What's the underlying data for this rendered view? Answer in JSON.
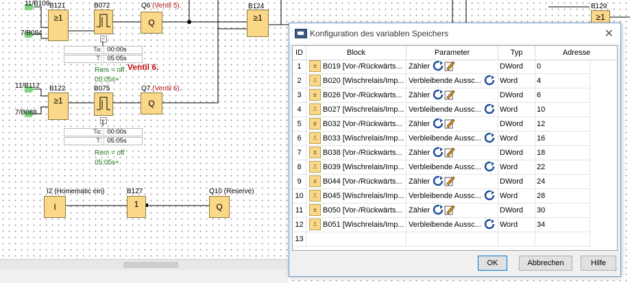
{
  "diagram": {
    "inputs": [
      {
        "label": "11/B109"
      },
      {
        "label": "7/B084"
      },
      {
        "label": "11/B112"
      },
      {
        "label": "7/B088"
      }
    ],
    "blocks": [
      {
        "name": "B121",
        "symbol": "≥1"
      },
      {
        "name": "B072",
        "symbol": ""
      },
      {
        "name": "Q6",
        "symbol": "Q",
        "comment": "(Ventil 5)."
      },
      {
        "name": "B124",
        "symbol": "≥1"
      },
      {
        "name": "B122",
        "symbol": "≥1"
      },
      {
        "name": "B075",
        "symbol": ""
      },
      {
        "name": "Q7",
        "symbol": "Q",
        "comment": "(Ventil 6)."
      },
      {
        "name": "I2 (Homematic ein)",
        "symbol": "I"
      },
      {
        "name": "B127",
        "symbol": "1"
      },
      {
        "name": "Q10 (Reserve)",
        "symbol": "Q"
      },
      {
        "name": "B129",
        "symbol": "≥1"
      }
    ],
    "timer_params": [
      {
        "ta_key": "Ta",
        "ta_value": "00:00s",
        "t_key": "T",
        "t_value": "05:05s",
        "rem": "Rem = off",
        "time": "05:05s+"
      },
      {
        "ta_key": "Ta",
        "ta_value": "00:00s",
        "t_key": "T",
        "t_value": "05:05s",
        "rem": "Rem = off",
        "time": "05:05s+"
      }
    ],
    "note": "Ventil 6."
  },
  "dialog": {
    "title": "Konfiguration des variablen Speichers",
    "columns": [
      "ID",
      "Block",
      "Parameter",
      "Typ",
      "Adresse"
    ],
    "rows": [
      {
        "id": "1",
        "block": "B019 [Vor-/Rückwärts...",
        "param": "Zähler",
        "icon": "counter-icon",
        "type": "DWord",
        "addr": "0"
      },
      {
        "id": "2",
        "block": "B020 [Wischrelais/Imp...",
        "param": "Verbleibende Aussc...",
        "icon": "timer-icon",
        "type": "Word",
        "addr": "4"
      },
      {
        "id": "3",
        "block": "B026 [Vor-/Rückwärts...",
        "param": "Zähler",
        "icon": "counter-icon",
        "type": "DWord",
        "addr": "6"
      },
      {
        "id": "4",
        "block": "B027 [Wischrelais/Imp...",
        "param": "Verbleibende Aussc...",
        "icon": "timer-icon",
        "type": "Word",
        "addr": "10"
      },
      {
        "id": "5",
        "block": "B032 [Vor-/Rückwärts...",
        "param": "Zähler",
        "icon": "counter-icon",
        "type": "DWord",
        "addr": "12"
      },
      {
        "id": "6",
        "block": "B033 [Wischrelais/Imp...",
        "param": "Verbleibende Aussc...",
        "icon": "timer-icon",
        "type": "Word",
        "addr": "16"
      },
      {
        "id": "7",
        "block": "B038 [Vor-/Rückwärts...",
        "param": "Zähler",
        "icon": "counter-icon",
        "type": "DWord",
        "addr": "18"
      },
      {
        "id": "8",
        "block": "B039 [Wischrelais/Imp...",
        "param": "Verbleibende Aussc...",
        "icon": "timer-icon",
        "type": "Word",
        "addr": "22"
      },
      {
        "id": "9",
        "block": "B044 [Vor-/Rückwärts...",
        "param": "Zähler",
        "icon": "counter-icon",
        "type": "DWord",
        "addr": "24"
      },
      {
        "id": "10",
        "block": "B045 [Wischrelais/Imp...",
        "param": "Verbleibende Aussc...",
        "icon": "timer-icon",
        "type": "Word",
        "addr": "28"
      },
      {
        "id": "11",
        "block": "B050 [Vor-/Rückwärts...",
        "param": "Zähler",
        "icon": "counter-icon",
        "type": "DWord",
        "addr": "30"
      },
      {
        "id": "12",
        "block": "B051 [Wischrelais/Imp...",
        "param": "Verbleibende Aussc...",
        "icon": "timer-icon",
        "type": "Word",
        "addr": "34"
      },
      {
        "id": "13",
        "block": "",
        "param": "",
        "icon": "",
        "type": "",
        "addr": ""
      }
    ],
    "buttons": {
      "ok": "OK",
      "cancel": "Abbrechen",
      "help": "Hilfe"
    }
  }
}
